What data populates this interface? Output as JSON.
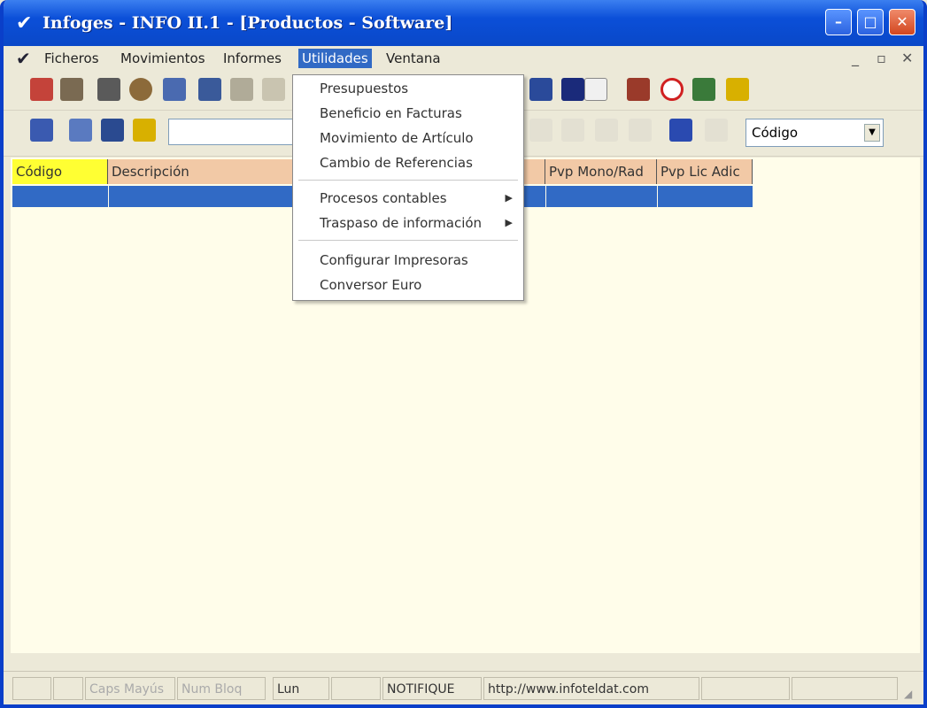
{
  "window": {
    "title": "Infoges - INFO II.1 - [Productos - Software]",
    "minimize_glyph": "–",
    "maximize_glyph": "□",
    "close_glyph": "✕"
  },
  "menubar": {
    "items": [
      "Ficheros",
      "Movimientos",
      "Informes",
      "Utilidades",
      "Ventana"
    ],
    "active": "Utilidades",
    "mdi_controls": [
      "_",
      "▫",
      "✕"
    ]
  },
  "dropdown": {
    "items": [
      {
        "label": "Presupuestos",
        "submenu": false
      },
      {
        "label": "Beneficio en Facturas",
        "submenu": false
      },
      {
        "label": "Movimiento de Artículo",
        "submenu": false
      },
      {
        "label": "Cambio de Referencias",
        "submenu": false
      },
      {
        "label": "Procesos contables",
        "submenu": true
      },
      {
        "label": "Traspaso de información",
        "submenu": true
      },
      {
        "label": "Configurar Impresoras",
        "submenu": false
      },
      {
        "label": "Conversor Euro",
        "submenu": false
      }
    ]
  },
  "toolbar2": {
    "combo_value": "Código"
  },
  "grid": {
    "columns": [
      "Código",
      "Descripción",
      "Pvp Mono/Rad",
      "Pvp Lic Adic"
    ],
    "colors": {
      "codigo_header": "#ffff33",
      "header": "#f2c9a6",
      "selected_row": "#316ac5"
    }
  },
  "statusbar": {
    "panels": [
      "",
      "",
      "Caps Mayús",
      "Num Bloq",
      "Lun",
      "",
      "NOTIFIQUE",
      "http://www.infoteldat.com",
      "",
      ""
    ]
  },
  "colors": {
    "titlebar": "#0b4fd8",
    "client_bg": "#fffdea",
    "menu_highlight": "#316ac5"
  }
}
